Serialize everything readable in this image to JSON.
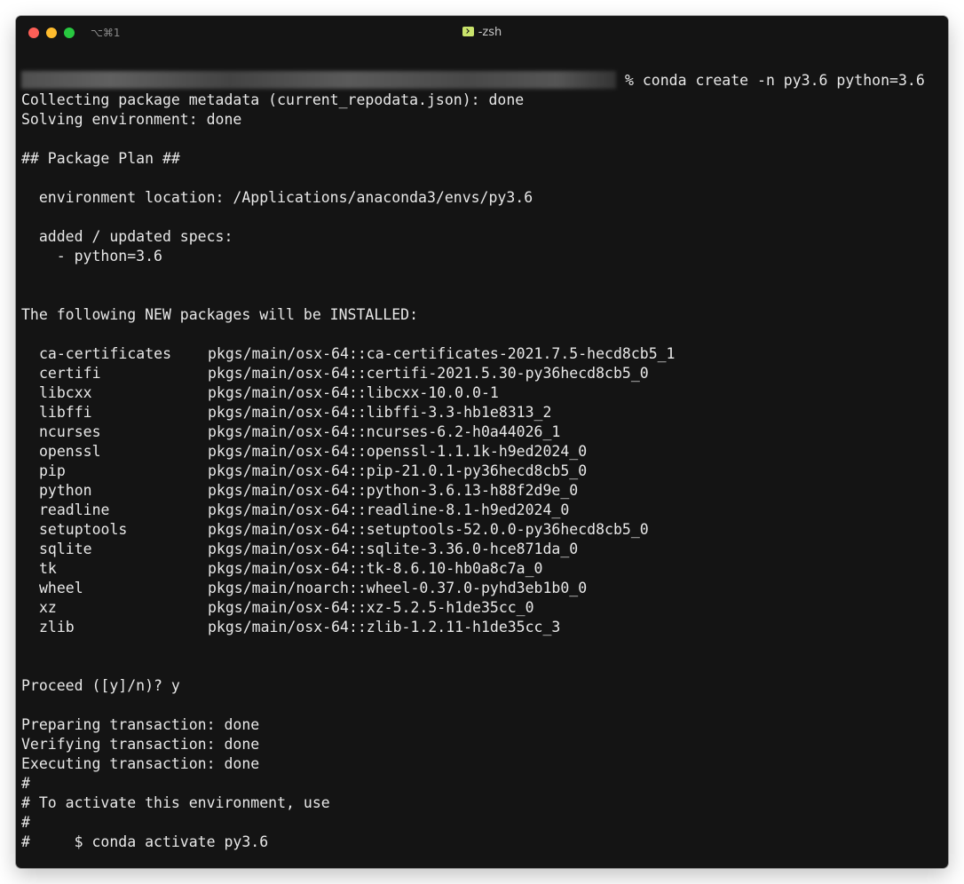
{
  "window": {
    "shortcut": "⌥⌘1",
    "title": "-zsh"
  },
  "terminal": {
    "command": "% conda create -n py3.6 python=3.6",
    "lines_before": [
      "Collecting package metadata (current_repodata.json): done",
      "Solving environment: done",
      "",
      "## Package Plan ##",
      "",
      "  environment location: /Applications/anaconda3/envs/py3.6",
      "",
      "  added / updated specs:",
      "    - python=3.6",
      "",
      "",
      "The following NEW packages will be INSTALLED:",
      ""
    ],
    "packages": [
      {
        "name": "ca-certificates",
        "spec": "pkgs/main/osx-64::ca-certificates-2021.7.5-hecd8cb5_1"
      },
      {
        "name": "certifi",
        "spec": "pkgs/main/osx-64::certifi-2021.5.30-py36hecd8cb5_0"
      },
      {
        "name": "libcxx",
        "spec": "pkgs/main/osx-64::libcxx-10.0.0-1"
      },
      {
        "name": "libffi",
        "spec": "pkgs/main/osx-64::libffi-3.3-hb1e8313_2"
      },
      {
        "name": "ncurses",
        "spec": "pkgs/main/osx-64::ncurses-6.2-h0a44026_1"
      },
      {
        "name": "openssl",
        "spec": "pkgs/main/osx-64::openssl-1.1.1k-h9ed2024_0"
      },
      {
        "name": "pip",
        "spec": "pkgs/main/osx-64::pip-21.0.1-py36hecd8cb5_0"
      },
      {
        "name": "python",
        "spec": "pkgs/main/osx-64::python-3.6.13-h88f2d9e_0"
      },
      {
        "name": "readline",
        "spec": "pkgs/main/osx-64::readline-8.1-h9ed2024_0"
      },
      {
        "name": "setuptools",
        "spec": "pkgs/main/osx-64::setuptools-52.0.0-py36hecd8cb5_0"
      },
      {
        "name": "sqlite",
        "spec": "pkgs/main/osx-64::sqlite-3.36.0-hce871da_0"
      },
      {
        "name": "tk",
        "spec": "pkgs/main/osx-64::tk-8.6.10-hb0a8c7a_0"
      },
      {
        "name": "wheel",
        "spec": "pkgs/main/noarch::wheel-0.37.0-pyhd3eb1b0_0"
      },
      {
        "name": "xz",
        "spec": "pkgs/main/osx-64::xz-5.2.5-h1de35cc_0"
      },
      {
        "name": "zlib",
        "spec": "pkgs/main/osx-64::zlib-1.2.11-h1de35cc_3"
      }
    ],
    "lines_after": [
      "",
      "",
      "Proceed ([y]/n)? y",
      "",
      "Preparing transaction: done",
      "Verifying transaction: done",
      "Executing transaction: done",
      "#",
      "# To activate this environment, use",
      "#",
      "#     $ conda activate py3.6"
    ]
  }
}
